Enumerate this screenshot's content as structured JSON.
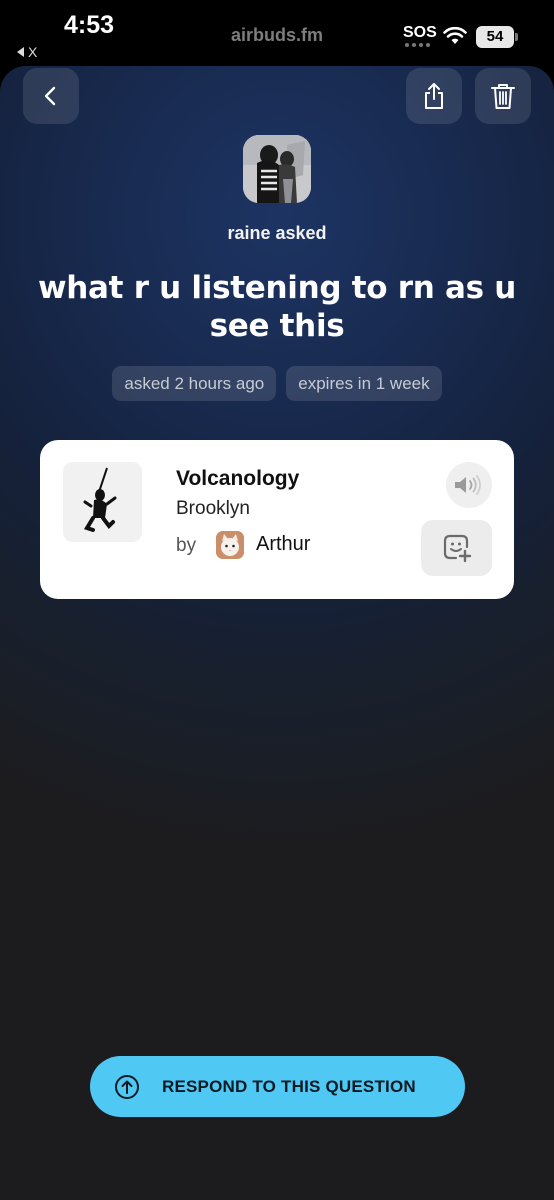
{
  "status_bar": {
    "time": "4:53",
    "back_app": "X",
    "url": "airbuds.fm",
    "sos": "SOS",
    "battery": "54"
  },
  "toolbar": {
    "back_icon": "chevron-left-icon",
    "share_icon": "share-icon",
    "delete_icon": "trash-icon"
  },
  "question": {
    "asker_label": "raine asked",
    "text": "what r u listening to rn as u see this",
    "asked_ago": "asked 2 hours ago",
    "expires": "expires in 1 week"
  },
  "track_card": {
    "song": "Volcanology",
    "artist": "Brooklyn",
    "by_label": "by",
    "shared_by": "Arthur",
    "speaker_icon": "speaker-icon",
    "sticker_icon": "add-sticker-icon"
  },
  "respond_button": {
    "label": "RESPOND TO THIS QUESTION",
    "icon": "arrow-up-circle-icon",
    "color": "#4fc8f4"
  }
}
